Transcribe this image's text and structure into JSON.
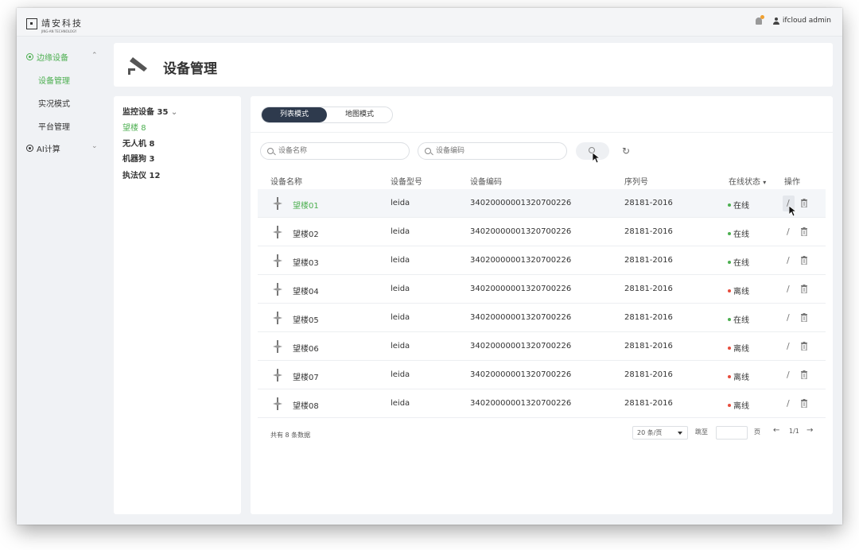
{
  "brand": {
    "name": "靖安科技",
    "sub": "JING-AN TECHNOLOGY"
  },
  "topbar": {
    "user": "ifcloud admin"
  },
  "sidebar": {
    "groups": [
      {
        "label": "边缘设备",
        "items": [
          "设备管理",
          "实况模式",
          "平台管理"
        ],
        "active_item": "设备管理"
      },
      {
        "label": "AI计算",
        "items": []
      }
    ]
  },
  "header": {
    "title": "设备管理"
  },
  "tree": {
    "root": {
      "label": "监控设备",
      "count": "35"
    },
    "items": [
      {
        "label": "望楼",
        "count": "8",
        "active": true
      },
      {
        "label": "无人机",
        "count": "8"
      },
      {
        "label": "机器狗",
        "count": "3"
      },
      {
        "label": "执法仪",
        "count": "12"
      }
    ]
  },
  "modes": [
    "列表模式",
    "地图模式"
  ],
  "active_mode": "列表模式",
  "search": {
    "name_placeholder": "设备名称",
    "code_placeholder": "设备编码"
  },
  "table": {
    "columns": [
      "设备名称",
      "设备型号",
      "设备编码",
      "序列号",
      "在线状态",
      "操作"
    ],
    "rows": [
      {
        "name": "望楼01",
        "model": "leida",
        "code": "34020000001320700226",
        "serial": "28181-2016",
        "status": "在线"
      },
      {
        "name": "望楼02",
        "model": "leida",
        "code": "34020000001320700226",
        "serial": "28181-2016",
        "status": "在线"
      },
      {
        "name": "望楼03",
        "model": "leida",
        "code": "34020000001320700226",
        "serial": "28181-2016",
        "status": "在线"
      },
      {
        "name": "望楼04",
        "model": "leida",
        "code": "34020000001320700226",
        "serial": "28181-2016",
        "status": "离线"
      },
      {
        "name": "望楼05",
        "model": "leida",
        "code": "34020000001320700226",
        "serial": "28181-2016",
        "status": "在线"
      },
      {
        "name": "望楼06",
        "model": "leida",
        "code": "34020000001320700226",
        "serial": "28181-2016",
        "status": "离线"
      },
      {
        "name": "望楼07",
        "model": "leida",
        "code": "34020000001320700226",
        "serial": "28181-2016",
        "status": "离线"
      },
      {
        "name": "望楼08",
        "model": "leida",
        "code": "34020000001320700226",
        "serial": "28181-2016",
        "status": "离线"
      }
    ]
  },
  "footer": {
    "total": "共有 8 条数据",
    "page_size": "20 条/页",
    "jump_label": "跳至",
    "page_label": "页",
    "page_info": "1/1",
    "prev": "←",
    "next": "→"
  },
  "colors": {
    "online": "#4caf50",
    "offline": "#e74c3c",
    "accent": "#4caf50",
    "dark": "#2e3a4d"
  }
}
